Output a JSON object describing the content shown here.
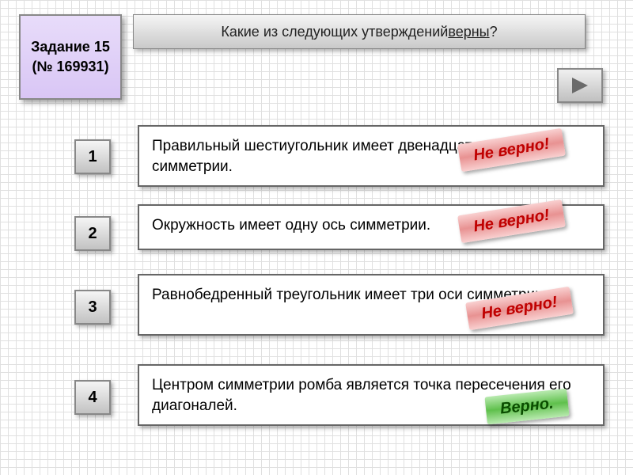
{
  "task": {
    "label_line1": "Задание 15",
    "label_line2": "(№ 169931)"
  },
  "question": {
    "prefix": "Какие из следующих утверждений ",
    "underlined": "верны",
    "suffix": "?"
  },
  "options": {
    "n1": "1",
    "n2": "2",
    "n3": "3",
    "n4": "4",
    "a1": "Правильный шестиугольник имеет двенадцать осей симметрии.",
    "a2": "Окружность имеет одну ось симметрии.",
    "a3": "Равнобедренный треугольник имеет три оси симметрии.",
    "a4": "Центром симметрии ромба является точка пересечения его диагоналей."
  },
  "stamps": {
    "wrong": "Не верно!",
    "correct": "Верно."
  }
}
